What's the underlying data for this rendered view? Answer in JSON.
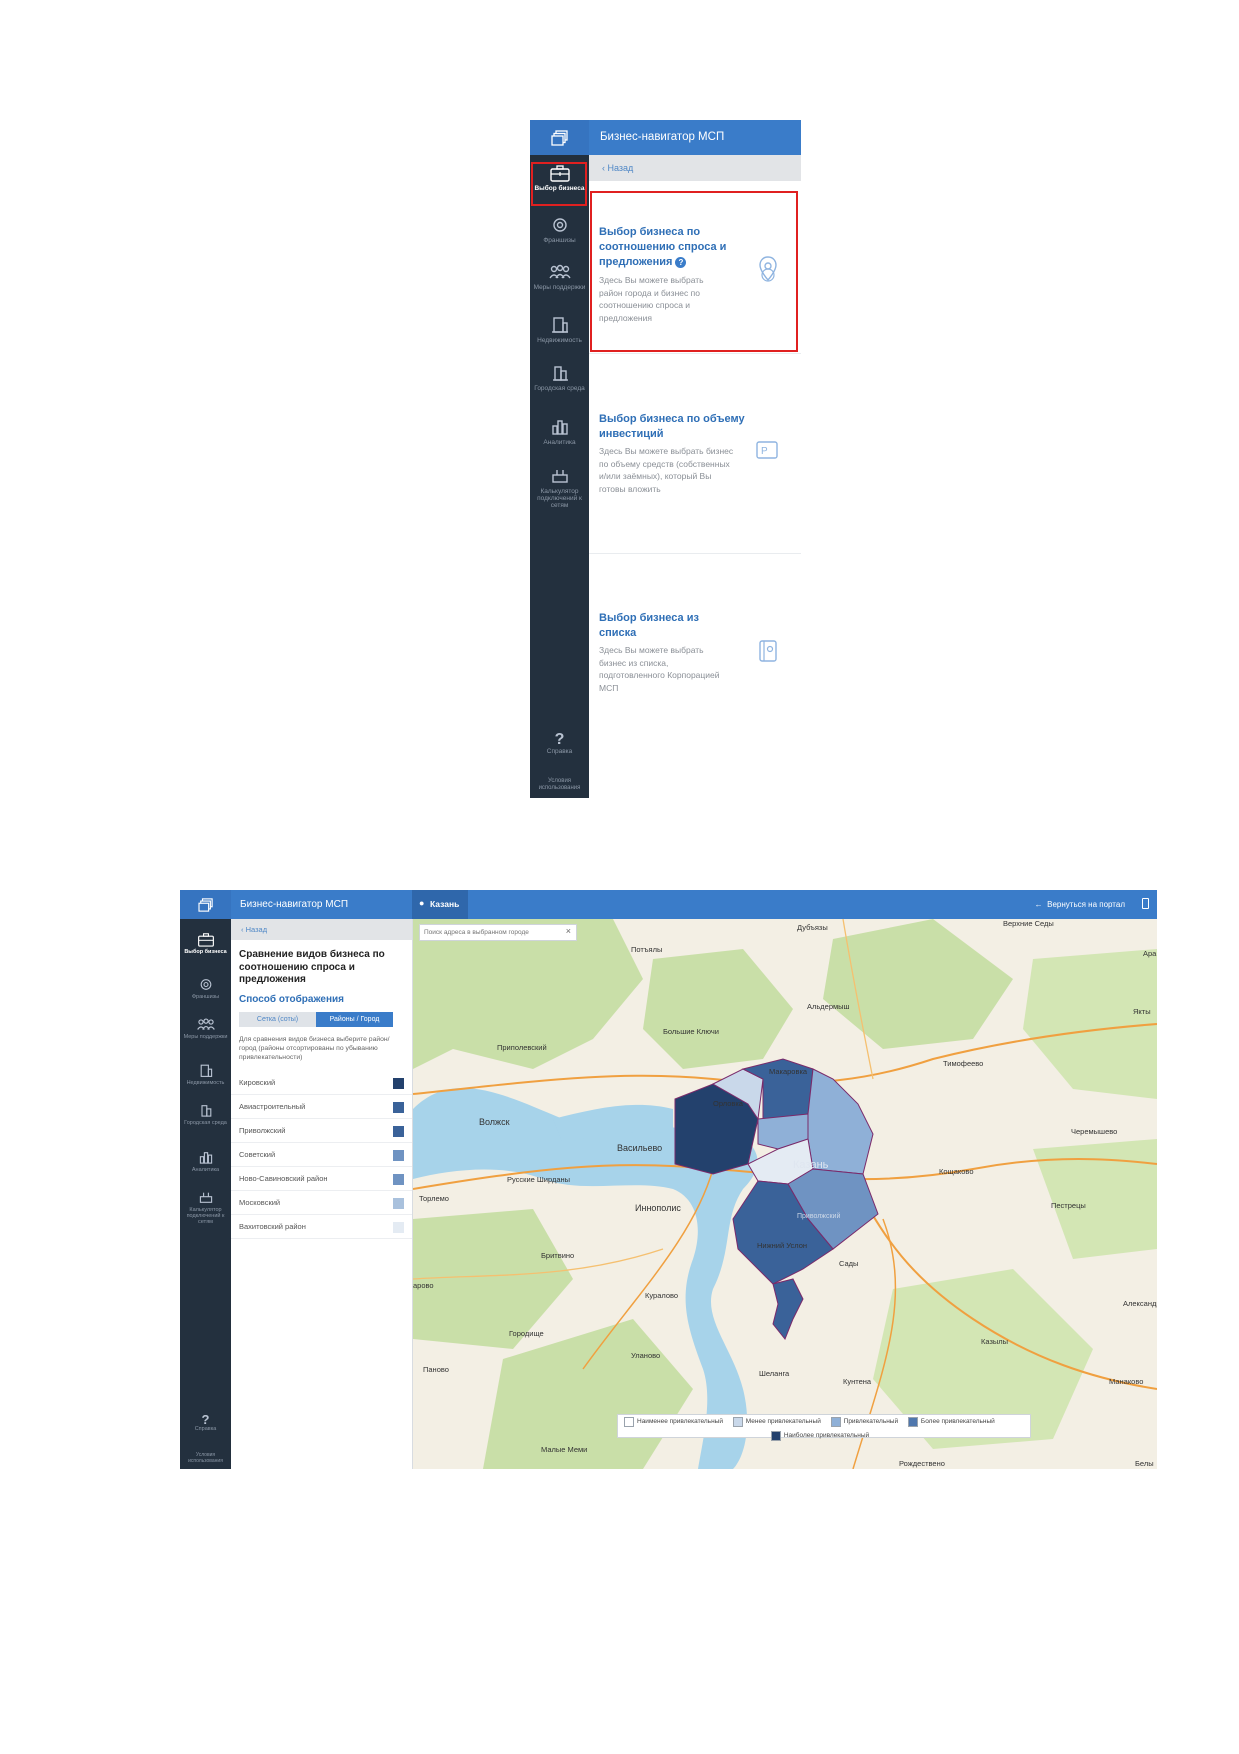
{
  "shot1": {
    "app_title": "Бизнес-навигатор МСП",
    "back_label": "Назад",
    "nav": [
      {
        "label": "Выбор бизнеса",
        "icon": "briefcase-icon"
      },
      {
        "label": "Франшизы",
        "icon": "gear-icon"
      },
      {
        "label": "Меры поддержки",
        "icon": "people-icon"
      },
      {
        "label": "Недвижимость",
        "icon": "building-icon"
      },
      {
        "label": "Городская среда",
        "icon": "city-icon"
      },
      {
        "label": "Аналитика",
        "icon": "bar-chart-icon"
      },
      {
        "label": "Калькулятор подключений к сетям",
        "icon": "plug-icon"
      }
    ],
    "help_label": "Справка",
    "terms_label": "Условия использования",
    "cards": [
      {
        "title": "Выбор бизнеса по соотношению спроса и предложения",
        "desc": "Здесь Вы можете выбрать район города и бизнес по соотношению спроса и предложения",
        "icon": "location-pin-icon"
      },
      {
        "title": "Выбор бизнеса по объему инвестиций",
        "desc": "Здесь Вы можете выбрать бизнес по объему средств (собственных и/или заёмных), который Вы готовы вложить",
        "icon": "wallet-icon"
      },
      {
        "title": "Выбор бизнеса из списка",
        "desc": "Здесь Вы можете выбрать бизнес из списка, подготовленного Корпорацией МСП",
        "icon": "notebook-icon"
      }
    ],
    "colors": {
      "highlight": "#e02020",
      "accent": "#3a7cc9",
      "rail": "#23303e"
    }
  },
  "shot2": {
    "app_title": "Бизнес-навигатор МСП",
    "city": "Казань",
    "return_label": "Вернуться на портал",
    "back_label": "Назад",
    "search_placeholder": "Поиск адреса в выбранном городе",
    "panel_title": "Сравнение видов бизнеса по соотношению спроса и предложения",
    "display_heading": "Способ отображения",
    "toggle": {
      "grid": "Сетка (соты)",
      "districts": "Районы / Город",
      "active": "districts"
    },
    "instructions": "Для сравнения видов бизнеса выберите район/город (районы отсортированы по убыванию привлекательности)",
    "nav": [
      {
        "label": "Выбор бизнеса",
        "icon": "briefcase-icon"
      },
      {
        "label": "Франшизы",
        "icon": "gear-icon"
      },
      {
        "label": "Меры поддержки",
        "icon": "people-icon"
      },
      {
        "label": "Недвижимость",
        "icon": "building-icon"
      },
      {
        "label": "Городская среда",
        "icon": "city-icon"
      },
      {
        "label": "Аналитика",
        "icon": "bar-chart-icon"
      },
      {
        "label": "Калькулятор подключений к сетям",
        "icon": "plug-icon"
      }
    ],
    "help_label": "Справка",
    "terms_label": "Условия использования",
    "districts": [
      {
        "name": "Кировский",
        "color": "#23416d"
      },
      {
        "name": "Авиастроительный",
        "color": "#3a6299"
      },
      {
        "name": "Приволжский",
        "color": "#3a6299"
      },
      {
        "name": "Советский",
        "color": "#6f93c2"
      },
      {
        "name": "Ново-Савиновский район",
        "color": "#6f93c2"
      },
      {
        "name": "Московский",
        "color": "#a9c1dd"
      },
      {
        "name": "Вахитовский район",
        "color": "#e4ebf3"
      }
    ],
    "legend": [
      {
        "label": "Наименее привлекательный",
        "color": "#ffffff"
      },
      {
        "label": "Менее привлекательный",
        "color": "#c9d8ea"
      },
      {
        "label": "Привлекательный",
        "color": "#8fb0d7"
      },
      {
        "label": "Более привлекательный",
        "color": "#4f77ad"
      },
      {
        "label": "Наиболее привлекательный",
        "color": "#23416d"
      }
    ],
    "map_labels": {
      "dubyazy": "Дубъязы",
      "verhnie_sedy": "Верхние Седы",
      "ara": "Ара",
      "yakty": "Якты",
      "potyaly": "Потъялы",
      "aldermysh": "Альдермыш",
      "bolshie_klyuchi": "Большие Ключи",
      "timofeevo": "Тимофеево",
      "pripolevsky": "Приполевский",
      "makarovka": "Макаровка",
      "volzhsk": "Волжск",
      "orlovka": "Орловка",
      "vasilyevo": "Васильево",
      "chernyshevo": "Черемышево",
      "kazan": "Казань",
      "koshcheevo": "Кощаково",
      "russkie_shirdany": "Русские Ширданы",
      "torlemo": "Торлемо",
      "innopolis": "Иннополис",
      "pestretsy": "Пестрецы",
      "privolzhsky": "Приволжский",
      "nizhny_uslon": "Нижний Услон",
      "britvino": "Бритвино",
      "kurlovo": "Куралово",
      "sady": "Сады",
      "arovo": "арово",
      "aleksandrovka": "Александр",
      "gorodishche": "Городище",
      "kazyly": "Казылы",
      "ulyanovo": "Уланово",
      "panovo": "Паново",
      "shelanga": "Шеланга",
      "kuntena": "Кунтена",
      "manaevo": "Манаково",
      "malye_meny": "Малые Меми",
      "rozhdestveno": "Рождествено",
      "belye": "Белы"
    }
  }
}
